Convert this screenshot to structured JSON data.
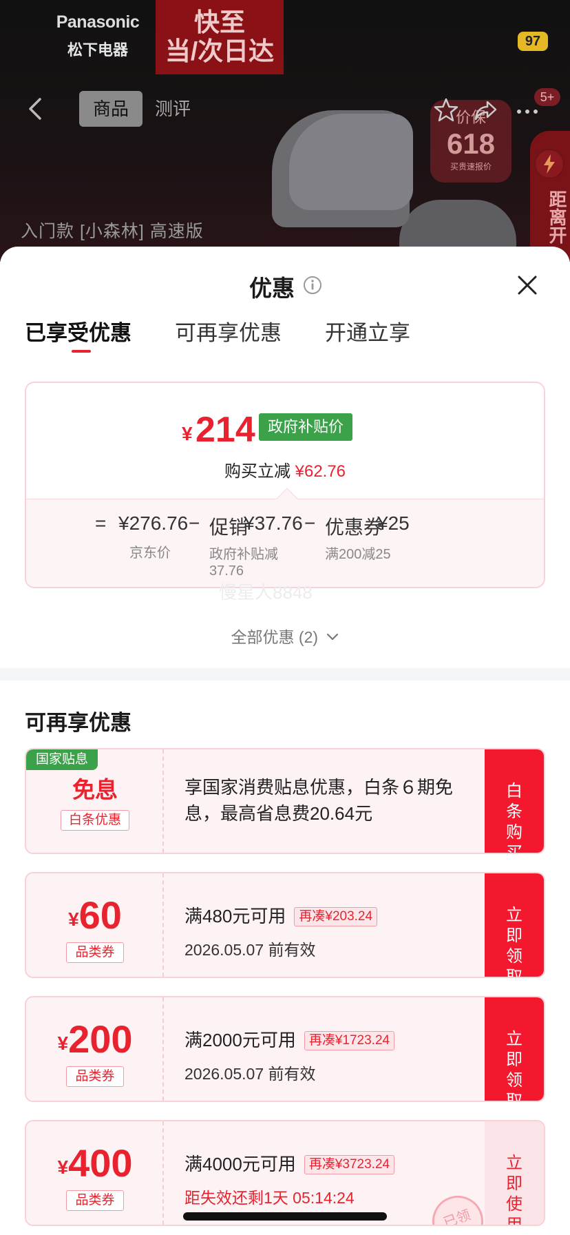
{
  "background_page": {
    "brand_en": "Panasonic",
    "brand_zh": "松下电器",
    "delivery_line1": "快至",
    "delivery_line2": "当/次日达",
    "message_count": "97",
    "tabs": [
      "商品",
      "测评"
    ],
    "more_badge": "5+",
    "seal_line1": "价保",
    "seal_line2": "618",
    "seal_line3": "买贵速报价",
    "timer_text": "距离开",
    "product_caption": "入门款 [小森林] 高速版"
  },
  "sheet": {
    "title": "优惠",
    "tabs": [
      "已享受优惠",
      "可再享优惠",
      "开通立享"
    ],
    "active_tab": 0
  },
  "summary": {
    "currency": "¥",
    "final_price": "214",
    "gov_tag": "政府补贴价",
    "reduce_label": "购买立减",
    "reduce_value": "¥62.76",
    "eq": "=",
    "jd_price": "¥276.76",
    "minus1": "−",
    "promo_label": "促销",
    "promo_value": "¥37.76",
    "minus2": "−",
    "coupon_label": "优惠券",
    "coupon_value": "¥25",
    "jd_price_label": "京东价",
    "promo_note_line1": "政府补贴减",
    "promo_note_line2": "37.76",
    "coupon_note": "满200减25",
    "watermark": "慢星人8848",
    "all_offers": "全部优惠 (2)"
  },
  "more_section": {
    "title": "可再享优惠",
    "interest_free": {
      "tag": "国家贴息",
      "title": "免息",
      "sub_tag": "白条优惠",
      "desc": "享国家消费贴息优惠，白条６期免息，最高省息费20.64元",
      "button": "白条购买"
    },
    "coupons": [
      {
        "currency": "¥",
        "amount": "60",
        "tag": "品类券",
        "condition": "满480元可用",
        "again": "再凑¥203.24",
        "validity": "2026.05.07 前有效",
        "button": "立即领取"
      },
      {
        "currency": "¥",
        "amount": "200",
        "tag": "品类券",
        "condition": "满2000元可用",
        "again": "再凑¥1723.24",
        "validity": "2026.05.07 前有效",
        "button": "立即领取"
      },
      {
        "currency": "¥",
        "amount": "400",
        "tag": "品类券",
        "condition": "满4000元可用",
        "again": "再凑¥3723.24",
        "validity": "距失效还剩1天 05:14:24",
        "button": "立即使用"
      }
    ],
    "stamp_text": "已领"
  },
  "colors": {
    "accent_red": "#e8232f",
    "button_red": "#f3182d",
    "gov_green": "#3ca24a",
    "card_pink": "#fdf3f4"
  },
  "icons": {
    "back": "chevron-left-icon",
    "star": "star-icon",
    "share": "share-icon",
    "more": "more-dots-icon",
    "info": "info-icon",
    "close": "close-icon",
    "chevron": "chevron-down-icon"
  }
}
